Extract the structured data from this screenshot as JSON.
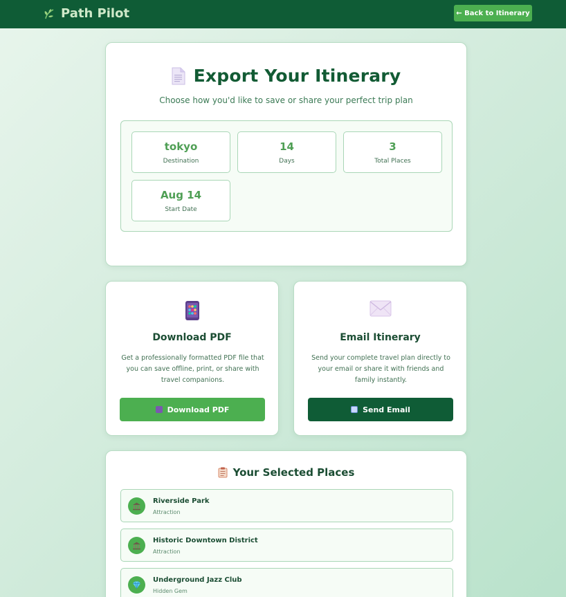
{
  "nav": {
    "brand": "Path Pilot",
    "back_label": "← Back to Itinerary"
  },
  "header": {
    "title": "Export Your Itinerary",
    "subtitle": "Choose how you'd like to save or share your perfect trip plan"
  },
  "summary": [
    {
      "value": "tokyo",
      "label": "Destination"
    },
    {
      "value": "14",
      "label": "Days"
    },
    {
      "value": "3",
      "label": "Total Places"
    },
    {
      "value": "Aug 14",
      "label": "Start Date"
    }
  ],
  "options": {
    "pdf": {
      "title": "Download PDF",
      "description": "Get a professionally formatted PDF file that you can save offline, print, or share with travel companions.",
      "button": "Download PDF",
      "icon": "phone-icon"
    },
    "email": {
      "title": "Email Itinerary",
      "description": "Send your complete travel plan directly to your email or share it with friends and family instantly.",
      "button": "Send Email",
      "icon": "envelope-icon"
    }
  },
  "places": {
    "title": "Your Selected Places",
    "items": [
      {
        "name": "Riverside Park",
        "type": "Attraction",
        "icon": "landmark-icon"
      },
      {
        "name": "Historic Downtown District",
        "type": "Attraction",
        "icon": "landmark-icon"
      },
      {
        "name": "Underground Jazz Club",
        "type": "Hidden Gem",
        "icon": "gem-icon"
      }
    ]
  },
  "colors": {
    "nav_bg": "#0f5c36",
    "accent": "#4caf50",
    "dark_button": "#0f5c36",
    "stat_value": "#4f9f55"
  }
}
